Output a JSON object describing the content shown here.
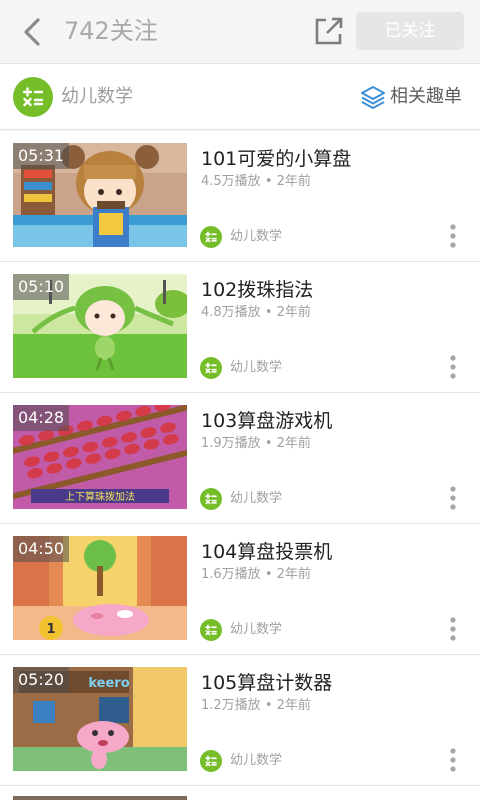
{
  "header": {
    "title": "742关注",
    "follow_label": "已关注",
    "icons": {
      "back": "chevron-left-icon",
      "share": "share-external-icon"
    }
  },
  "channel": {
    "name": "幼儿数学",
    "related_label": "相关趣单",
    "icons": {
      "channel": "math-operators-icon",
      "related": "layers-icon"
    },
    "accent_color": "#76bd2a",
    "link_color": "#3a8fd8"
  },
  "videos": [
    {
      "duration": "05:31",
      "title": "101可爱的小算盘",
      "plays": "4.5万播放",
      "sep": "•",
      "age": "2年前",
      "channel": "幼儿数学"
    },
    {
      "duration": "05:10",
      "title": "102拨珠指法",
      "plays": "4.8万播放",
      "sep": "•",
      "age": "2年前",
      "channel": "幼儿数学"
    },
    {
      "duration": "04:28",
      "title": "103算盘游戏机",
      "plays": "1.9万播放",
      "sep": "•",
      "age": "2年前",
      "channel": "幼儿数学"
    },
    {
      "duration": "04:50",
      "title": "104算盘投票机",
      "plays": "1.6万播放",
      "sep": "•",
      "age": "2年前",
      "channel": "幼儿数学"
    },
    {
      "duration": "05:20",
      "title": "105算盘计数器",
      "plays": "1.2万播放",
      "sep": "•",
      "age": "2年前",
      "channel": "幼儿数学"
    }
  ],
  "thumbnail_texts": {
    "caption_3": "上下算珠拨加法",
    "sign_5": "keero"
  }
}
